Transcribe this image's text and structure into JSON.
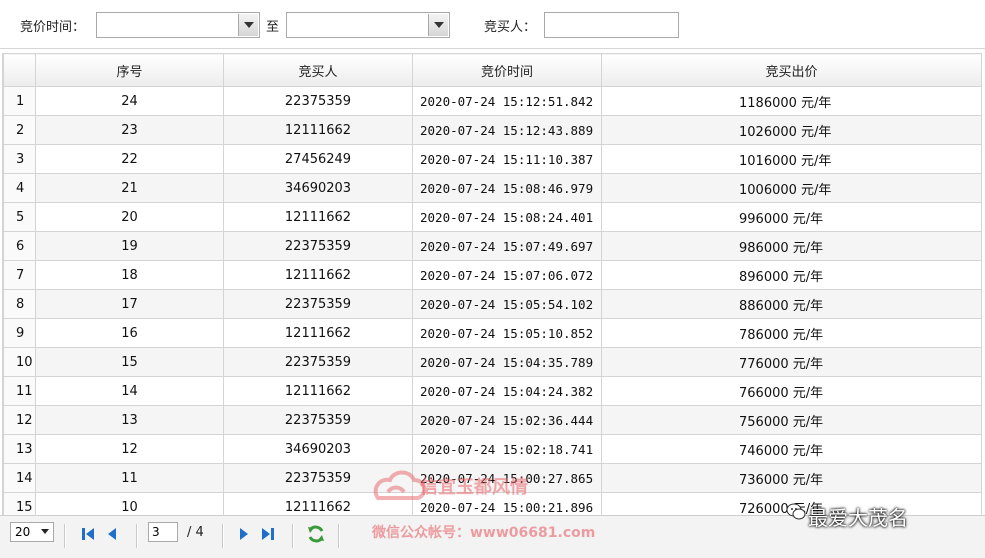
{
  "filter": {
    "time_label": "竞价时间：",
    "to_label": "至",
    "bidder_label": "竞买人：",
    "time_from_value": "",
    "time_to_value": "",
    "bidder_value": ""
  },
  "table": {
    "columns": [
      "序号",
      "竞买人",
      "竞价时间",
      "竞买出价"
    ],
    "rows": [
      {
        "rn": "1",
        "seq": "24",
        "bidder": "22375359",
        "time": "2020-07-24 15:12:51.842",
        "price": "1186000 元/年"
      },
      {
        "rn": "2",
        "seq": "23",
        "bidder": "12111662",
        "time": "2020-07-24 15:12:43.889",
        "price": "1026000 元/年"
      },
      {
        "rn": "3",
        "seq": "22",
        "bidder": "27456249",
        "time": "2020-07-24 15:11:10.387",
        "price": "1016000 元/年"
      },
      {
        "rn": "4",
        "seq": "21",
        "bidder": "34690203",
        "time": "2020-07-24 15:08:46.979",
        "price": "1006000 元/年"
      },
      {
        "rn": "5",
        "seq": "20",
        "bidder": "12111662",
        "time": "2020-07-24 15:08:24.401",
        "price": "996000 元/年"
      },
      {
        "rn": "6",
        "seq": "19",
        "bidder": "22375359",
        "time": "2020-07-24 15:07:49.697",
        "price": "986000 元/年"
      },
      {
        "rn": "7",
        "seq": "18",
        "bidder": "12111662",
        "time": "2020-07-24 15:07:06.072",
        "price": "896000 元/年"
      },
      {
        "rn": "8",
        "seq": "17",
        "bidder": "22375359",
        "time": "2020-07-24 15:05:54.102",
        "price": "886000 元/年"
      },
      {
        "rn": "9",
        "seq": "16",
        "bidder": "12111662",
        "time": "2020-07-24 15:05:10.852",
        "price": "786000 元/年"
      },
      {
        "rn": "10",
        "seq": "15",
        "bidder": "22375359",
        "time": "2020-07-24 15:04:35.789",
        "price": "776000 元/年"
      },
      {
        "rn": "11",
        "seq": "14",
        "bidder": "12111662",
        "time": "2020-07-24 15:04:24.382",
        "price": "766000 元/年"
      },
      {
        "rn": "12",
        "seq": "13",
        "bidder": "22375359",
        "time": "2020-07-24 15:02:36.444",
        "price": "756000 元/年"
      },
      {
        "rn": "13",
        "seq": "12",
        "bidder": "34690203",
        "time": "2020-07-24 15:02:18.741",
        "price": "746000 元/年"
      },
      {
        "rn": "14",
        "seq": "11",
        "bidder": "22375359",
        "time": "2020-07-24 15:00:27.865",
        "price": "736000 元/年"
      },
      {
        "rn": "15",
        "seq": "10",
        "bidder": "12111662",
        "time": "2020-07-24 15:00:21.896",
        "price": "726000 元/年"
      }
    ]
  },
  "pager": {
    "page_size": "20",
    "current_page": "3",
    "total_pages": "/ 4"
  },
  "watermark": {
    "title": "信宜玉都风情",
    "subtitle": "微信公众帐号：www06681.com",
    "brand": "最爱大茂名"
  },
  "colors": {
    "header_bg": "#ececec",
    "even_row_bg": "#f5f5f5",
    "grid_border": "#d4d4d4",
    "pager_icon_blue": "#1f6fc9",
    "refresh_green": "#3a9a3a",
    "watermark_red": "#e8646a"
  }
}
